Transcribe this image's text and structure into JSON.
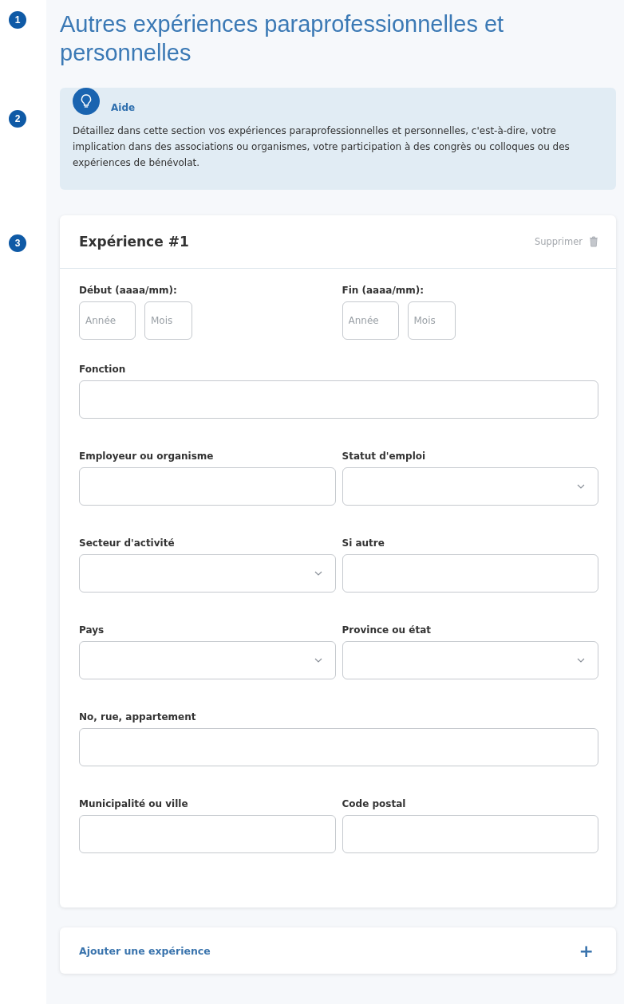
{
  "title": {
    "marker": "1",
    "text": "Autres expériences paraprofessionnelles et personnelles"
  },
  "help": {
    "marker": "2",
    "title": "Aide",
    "text": "Détaillez dans cette section vos expériences paraprofessionnelles et personnelles, c'est-à-dire, votre implication dans des associations ou organismes, votre participation à des congrès ou colloques ou des expériences de bénévolat."
  },
  "experience": {
    "marker": "3",
    "title": "Expérience #1",
    "delete": "Supprimer",
    "rows": [
      [
        {
          "kind": "date",
          "label": "Début (aaaa/mm):",
          "parts": [
            {
              "placeholder": "Année"
            },
            {
              "placeholder": "Mois"
            }
          ]
        },
        {
          "kind": "date",
          "label": "Fin (aaaa/mm):",
          "parts": [
            {
              "placeholder": "Année"
            },
            {
              "placeholder": "Mois"
            }
          ]
        }
      ],
      [
        {
          "kind": "text",
          "label": "Fonction"
        }
      ],
      [
        {
          "kind": "text",
          "label": "Employeur ou organisme"
        },
        {
          "kind": "select",
          "label": "Statut d'emploi"
        }
      ],
      [
        {
          "kind": "select",
          "label": "Secteur d'activité"
        },
        {
          "kind": "text",
          "label": "Si autre"
        }
      ],
      [
        {
          "kind": "select",
          "label": "Pays"
        },
        {
          "kind": "select",
          "label": "Province ou état"
        }
      ],
      [
        {
          "kind": "text",
          "label": "No, rue, appartement"
        }
      ],
      [
        {
          "kind": "text",
          "label": "Municipalité ou ville"
        },
        {
          "kind": "text",
          "label": "Code postal"
        }
      ]
    ]
  },
  "add": {
    "label": "Ajouter une expérience",
    "icon": "+"
  }
}
